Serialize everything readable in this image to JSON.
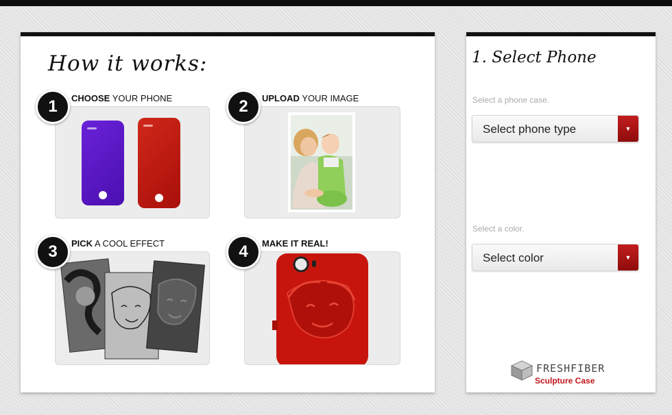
{
  "how_it_works": {
    "heading": "How it works:",
    "steps": [
      {
        "number": "1",
        "bold": "CHOOSE",
        "rest": " YOUR PHONE"
      },
      {
        "number": "2",
        "bold": "UPLOAD",
        "rest": " YOUR IMAGE"
      },
      {
        "number": "3",
        "bold": "PICK",
        "rest": " A COOL EFFECT"
      },
      {
        "number": "4",
        "bold": "MAKE IT REAL!",
        "rest": ""
      }
    ],
    "phone_colors": [
      "#5a16c4",
      "#c0180c"
    ]
  },
  "select_phone": {
    "title": "1. Select Phone",
    "phone_label": "Select a phone case.",
    "phone_select": "Select phone type",
    "color_label": "Select a color.",
    "color_select": "Select color",
    "dropdown_arrow": "▼"
  },
  "logo": {
    "brand": "FRESHFIBER",
    "tagline": "Sculpture Case"
  },
  "colors": {
    "accent_red": "#a8141a",
    "panel_bg": "#ececec"
  }
}
